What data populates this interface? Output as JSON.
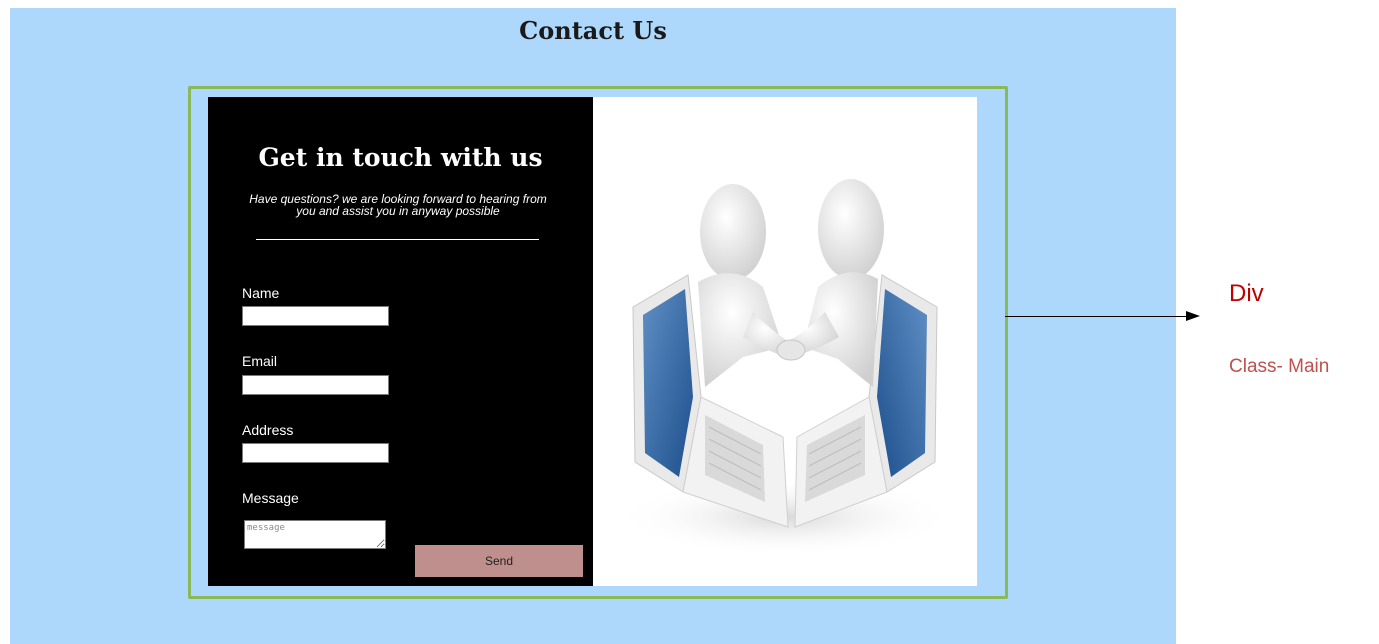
{
  "page": {
    "title": "Contact Us"
  },
  "form": {
    "heading": "Get in touch with us",
    "subtitle": "Have questions? we are looking forward to hearing from you and assist you in anyway possible",
    "fields": [
      {
        "label": "Name",
        "value": ""
      },
      {
        "label": "Email",
        "value": ""
      },
      {
        "label": "Address",
        "value": ""
      }
    ],
    "message": {
      "label": "Message",
      "placeholder": "message"
    },
    "send_label": "Send"
  },
  "illustration": {
    "icon": "handshake-laptops-illustration"
  },
  "annotation": {
    "element": "Div",
    "class_label": "Class- Main"
  },
  "colors": {
    "page_bg": "#add8fb",
    "frame_border": "#8ab95a",
    "form_bg": "#000000",
    "send_button": "#bf8f8d",
    "annotation_div": "#c00000",
    "annotation_class": "#c0504d"
  }
}
